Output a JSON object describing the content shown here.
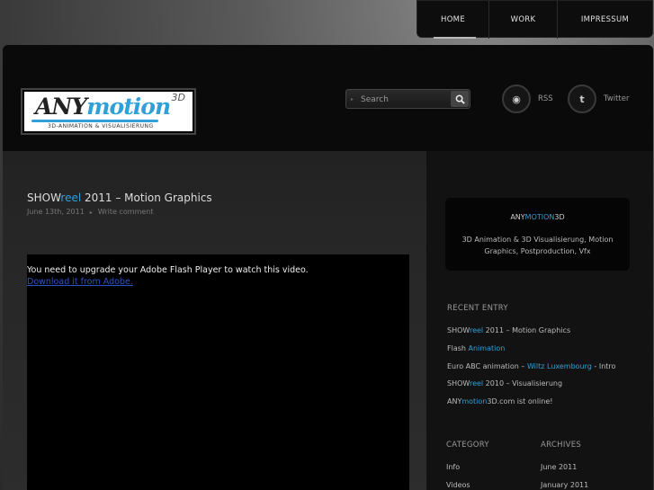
{
  "nav": {
    "items": [
      {
        "label": "HOME"
      },
      {
        "label": "WORK"
      },
      {
        "label": "IMPRESSUM"
      }
    ]
  },
  "logo": {
    "main_a": "ANY",
    "main_b": "motion",
    "suffix": "3D",
    "subtitle": "3D-ANIMATION & VISUALISIERUNG"
  },
  "search": {
    "placeholder": "Search"
  },
  "social": {
    "rss_label": "RSS",
    "rss_glyph": "◉",
    "twitter_label": "Twitter",
    "twitter_glyph": "t"
  },
  "post": {
    "title_a": "SHOW",
    "title_b": "reel",
    "title_c": " 2011 – Motion Graphics",
    "date": "June 13th, 2011",
    "comment_link": "Write comment",
    "flash_message": "You need to upgrade your Adobe Flash Player to watch this video.",
    "flash_link": "Download it from Adobe."
  },
  "sidebar": {
    "about": {
      "title_a": "ANY",
      "title_b": "MOTION",
      "title_c": "3D",
      "description": "3D Animation & 3D Visualisierung, Motion Graphics, Postproduction, Vfx"
    },
    "recent_heading": "RECENT ENTRY",
    "recent": [
      {
        "a": "SHOW",
        "b": "reel",
        "c": " 2011 – Motion Graphics"
      },
      {
        "a": "Flash ",
        "b": "Animation",
        "c": ""
      },
      {
        "a": "Euro ABC animation – ",
        "b": "Wiltz Luxembourg",
        "c": " - Intro"
      },
      {
        "a": "SHOW",
        "b": "reel",
        "c": " 2010 – Visualisierung"
      },
      {
        "a": "ANY",
        "b": "motion",
        "c": "3D.com ist online!"
      }
    ],
    "category_heading": "CATEGORY",
    "categories": [
      "Info",
      "Videos"
    ],
    "archives_heading": "ARCHIVES",
    "archives": [
      "June 2011",
      "January 2011"
    ]
  },
  "colors": {
    "accent": "#2fa0d8",
    "link": "#2c54c8"
  }
}
